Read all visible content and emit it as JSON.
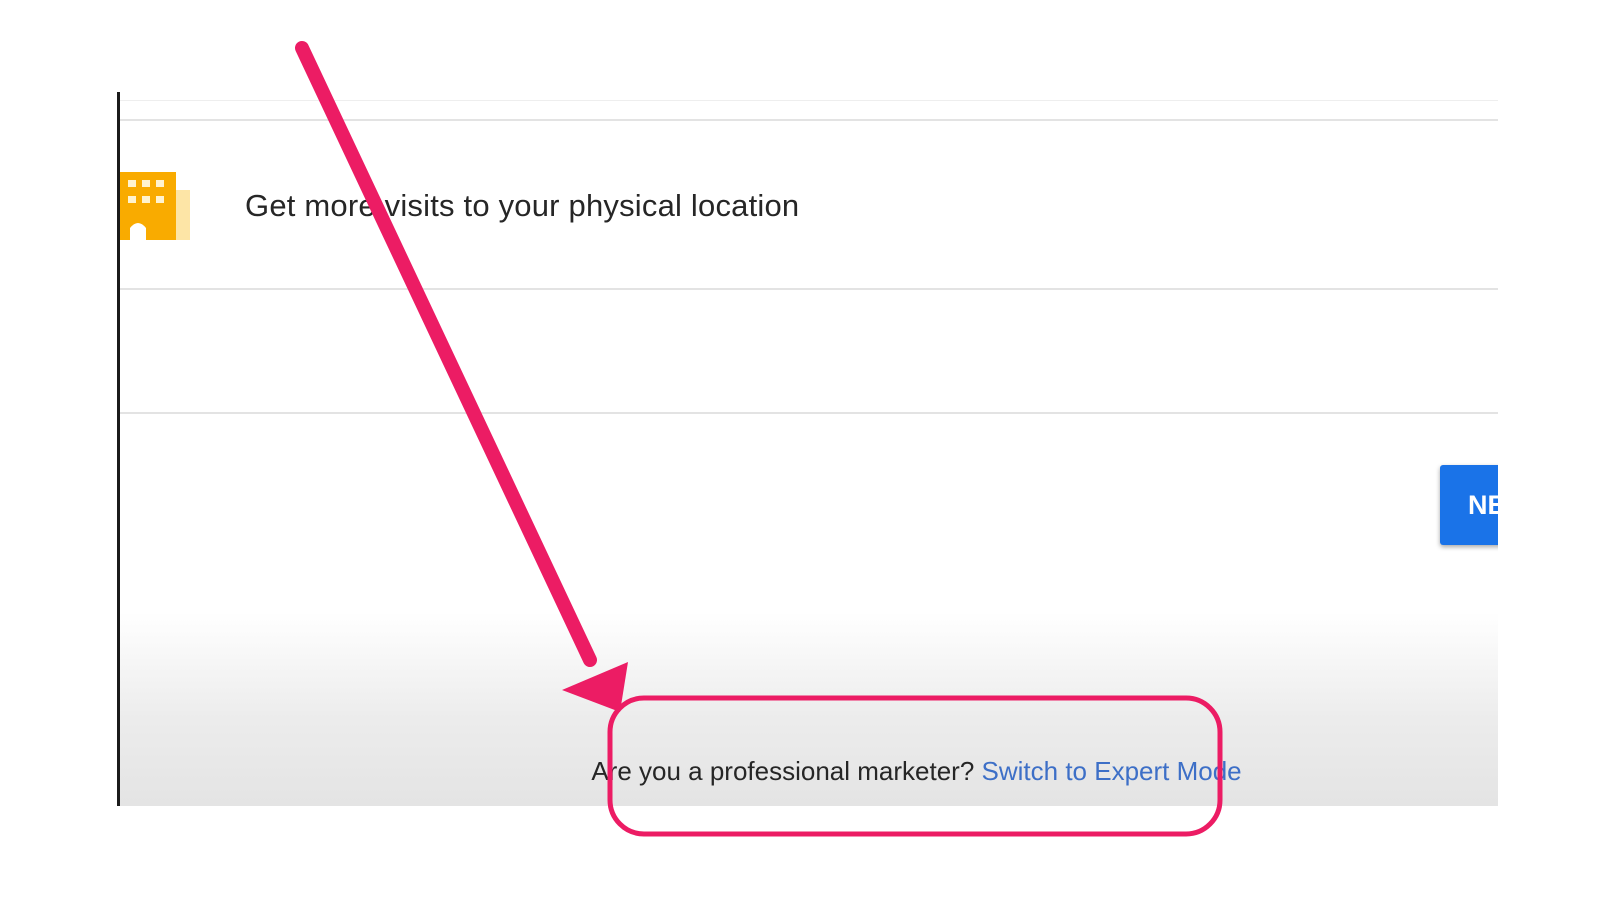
{
  "goal_option": {
    "label": "Get more visits to your physical location",
    "icon": "building-icon",
    "icon_color": "#f9ab00"
  },
  "next_button": {
    "label": "NE",
    "color": "#1a73e8"
  },
  "footer": {
    "question": "Are you a professional marketer?",
    "link_label": "Switch to Expert Mode"
  },
  "annotation": {
    "color": "#ec1c64",
    "arrow_icon": "arrow-icon",
    "highlight": "rounded-rectangle"
  }
}
